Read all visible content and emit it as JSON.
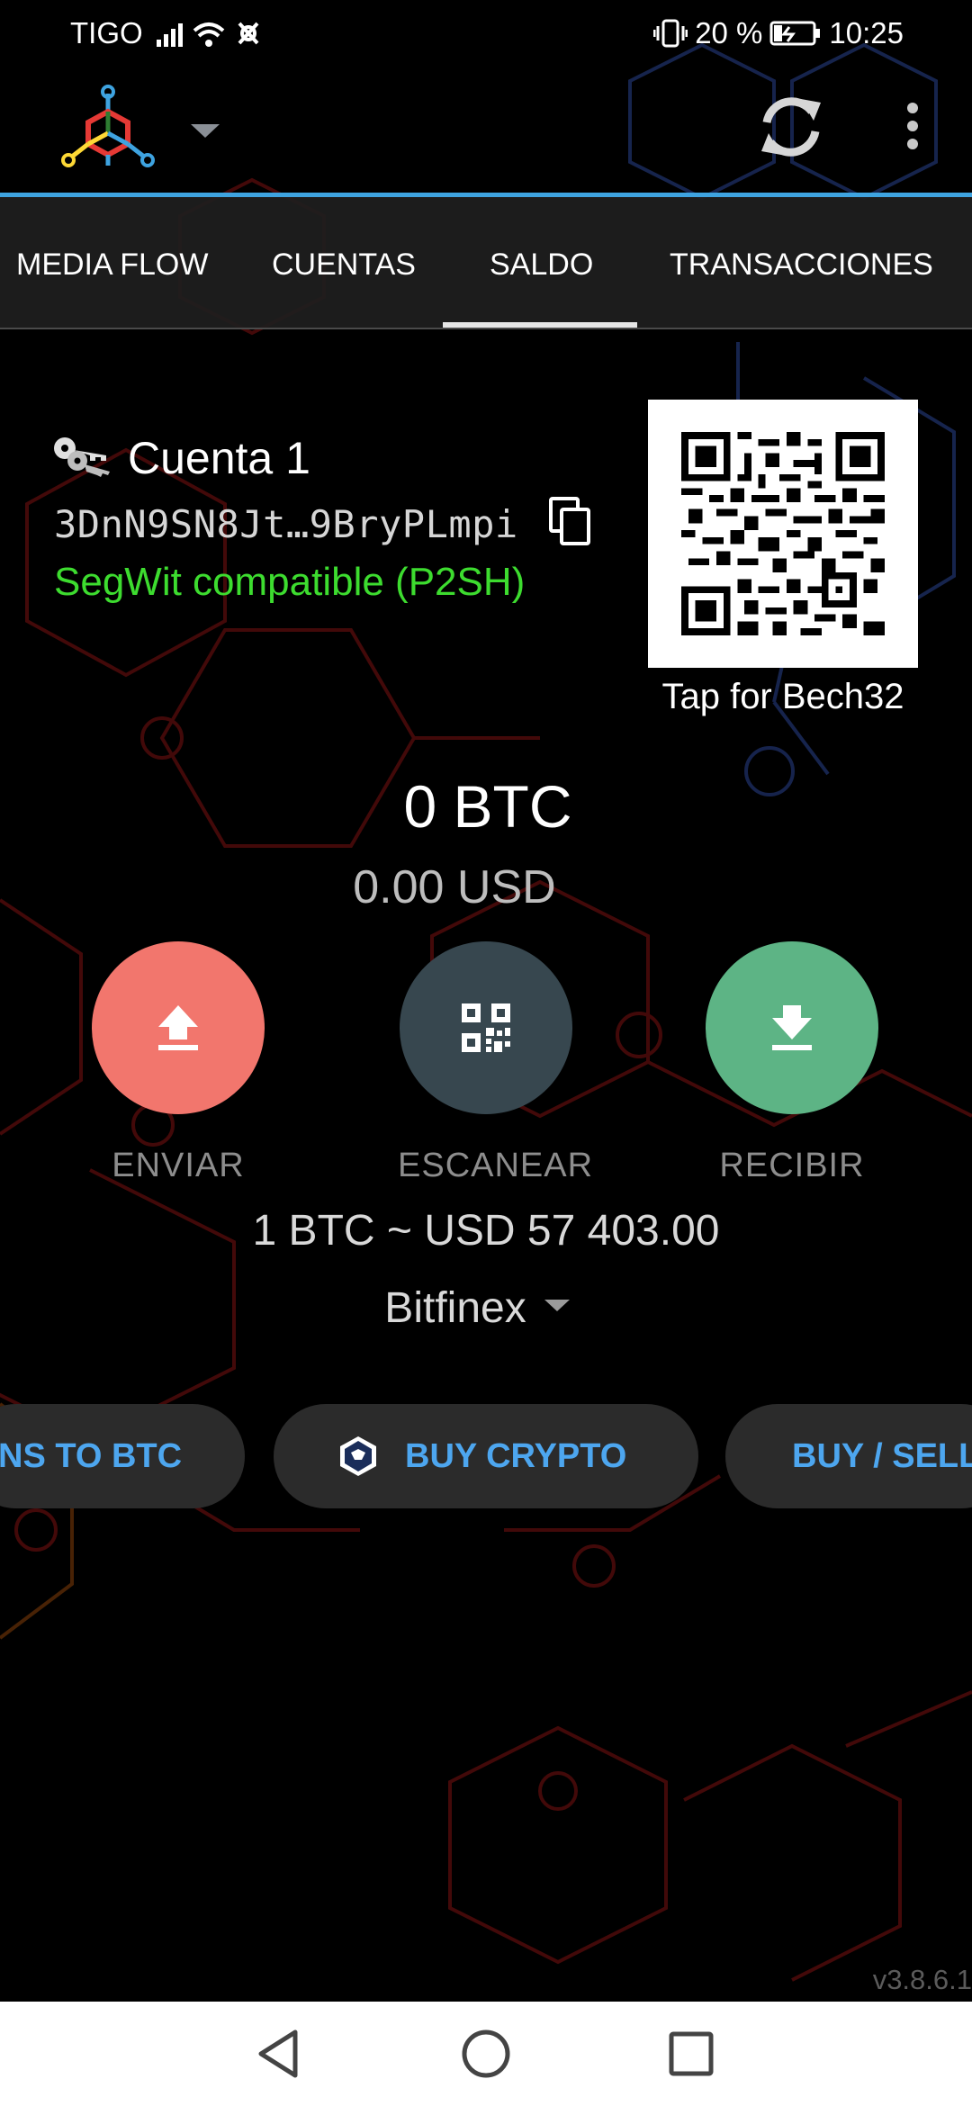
{
  "status_bar": {
    "carrier": "TIGO",
    "battery": "20 %",
    "time": "10:25",
    "icons": [
      "signal-icon",
      "wifi-icon",
      "notification-icon",
      "vibrate-icon",
      "battery-icon"
    ]
  },
  "app_bar": {
    "icons": [
      "app-logo",
      "dropdown-caret-icon",
      "refresh-icon",
      "more-vert-icon"
    ]
  },
  "tabs": [
    {
      "label": "MEDIA FLOW",
      "active": false
    },
    {
      "label": "CUENTAS",
      "active": false
    },
    {
      "label": "SALDO",
      "active": true
    },
    {
      "label": "TRANSACCIONES",
      "active": false
    }
  ],
  "account": {
    "name": "Cuenta 1",
    "address": "3DnN9SN8Jt…9BryPLmpi",
    "address_type": "SegWit compatible (P2SH)",
    "qr_caption": "Tap for Bech32"
  },
  "balance": {
    "btc": "0 BTC",
    "fiat": "0.00 USD"
  },
  "actions": [
    {
      "label": "ENVIAR",
      "icon": "upload-icon",
      "color": "#f2766d"
    },
    {
      "label": "ESCANEAR",
      "icon": "qr-scan-icon",
      "color": "#37474f"
    },
    {
      "label": "RECIBIR",
      "icon": "download-icon",
      "color": "#5db485"
    }
  ],
  "exchange_rate": {
    "text": "1 BTC ~ USD 57 403.00",
    "source": "Bitfinex"
  },
  "promo_pills": [
    {
      "label": "NS TO BTC"
    },
    {
      "label": "BUY CRYPTO"
    },
    {
      "label": "BUY / SELL"
    }
  ],
  "version": "v3.8.6.1",
  "colors": {
    "accent_blue": "#3ea3e0",
    "segwit_green": "#3ddc2f",
    "pill_text": "#4da6ef"
  }
}
